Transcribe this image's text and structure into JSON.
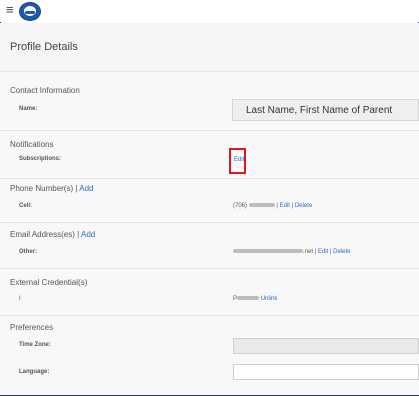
{
  "header": {
    "menu_icon": "hamburger-icon",
    "logo_icon": "logo-icon"
  },
  "page": {
    "title": "Profile Details"
  },
  "contact": {
    "section_title": "Contact Information",
    "name_label": "Name:",
    "name_value": "Last Name, First Name of Parent"
  },
  "notifications": {
    "section_title": "Notifications",
    "subscriptions_label": "Subscriptions:",
    "edit_link": "Edit"
  },
  "phone": {
    "section_title": "Phone Number(s)",
    "separator": "|",
    "add_link": "Add",
    "cell_label": "Cell:",
    "cell_prefix": "(706)",
    "edit_link": "Edit",
    "delete_link": "Delete"
  },
  "email": {
    "section_title": "Email Address(es)",
    "separator": "|",
    "add_link": "Add",
    "other_label": "Other:",
    "email_suffix": ".net",
    "edit_link": "Edit",
    "delete_link": "Delete"
  },
  "credentials": {
    "section_title": "External Credential(s)",
    "row_label": "I",
    "credential_prefix": "P",
    "unlink_link": "Unlink"
  },
  "preferences": {
    "section_title": "Preferences",
    "timezone_label": "Time Zone:",
    "timezone_value": "",
    "language_label": "Language:",
    "language_value": ""
  },
  "colors": {
    "link": "#2b6cc4",
    "highlight": "#e3161b",
    "frame": "#1f3f7a"
  }
}
